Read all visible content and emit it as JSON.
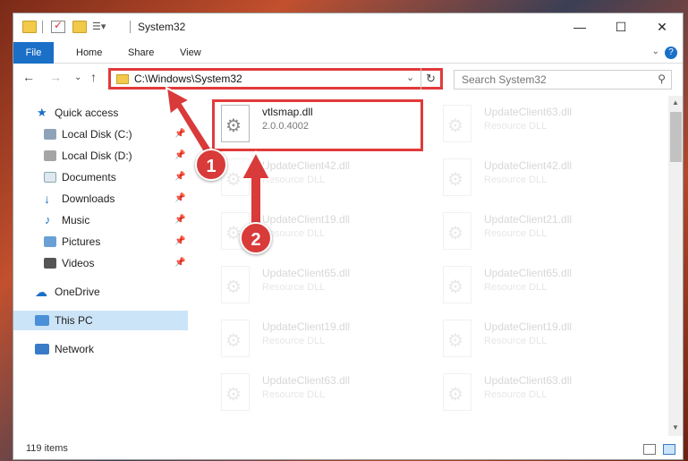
{
  "window": {
    "title": "System32"
  },
  "ribbon": {
    "tabs": [
      "File",
      "Home",
      "Share",
      "View"
    ]
  },
  "address": {
    "path": "C:\\Windows\\System32"
  },
  "search": {
    "placeholder": "Search System32"
  },
  "sidebar": {
    "items": [
      {
        "label": "Quick access",
        "icon": "star-icon"
      },
      {
        "label": "Local Disk (C:)",
        "icon": "drive-icon"
      },
      {
        "label": "Local Disk (D:)",
        "icon": "drive-icon"
      },
      {
        "label": "Documents",
        "icon": "document-icon"
      },
      {
        "label": "Downloads",
        "icon": "download-icon"
      },
      {
        "label": "Music",
        "icon": "music-icon"
      },
      {
        "label": "Pictures",
        "icon": "picture-icon"
      },
      {
        "label": "Videos",
        "icon": "video-icon"
      },
      {
        "label": "OneDrive",
        "icon": "cloud-icon"
      },
      {
        "label": "This PC",
        "icon": "computer-icon"
      },
      {
        "label": "Network",
        "icon": "network-icon"
      }
    ]
  },
  "files": [
    {
      "name": "vtlsmap.dll",
      "sub": "2.0.0.4002"
    },
    {
      "name": "UpdateClient63.dll",
      "sub": "Resource DLL"
    },
    {
      "name": "UpdateClient42.dll",
      "sub": "Resource DLL"
    },
    {
      "name": "UpdateClient42.dll",
      "sub": "Resource DLL"
    },
    {
      "name": "UpdateClient19.dll",
      "sub": "Resource DLL"
    },
    {
      "name": "UpdateClient21.dll",
      "sub": "Resource DLL"
    },
    {
      "name": "UpdateClient65.dll",
      "sub": "Resource DLL"
    },
    {
      "name": "UpdateClient65.dll",
      "sub": "Resource DLL"
    },
    {
      "name": "UpdateClient19.dll",
      "sub": "Resource DLL"
    },
    {
      "name": "UpdateClient19.dll",
      "sub": "Resource DLL"
    },
    {
      "name": "UpdateClient63.dll",
      "sub": "Resource DLL"
    },
    {
      "name": "UpdateClient63.dll",
      "sub": "Resource DLL"
    }
  ],
  "status": {
    "count": "119 items"
  },
  "annotations": {
    "step1": "1",
    "step2": "2"
  },
  "colors": {
    "accent": "#1a6fc7",
    "highlight": "#e23a3a"
  }
}
